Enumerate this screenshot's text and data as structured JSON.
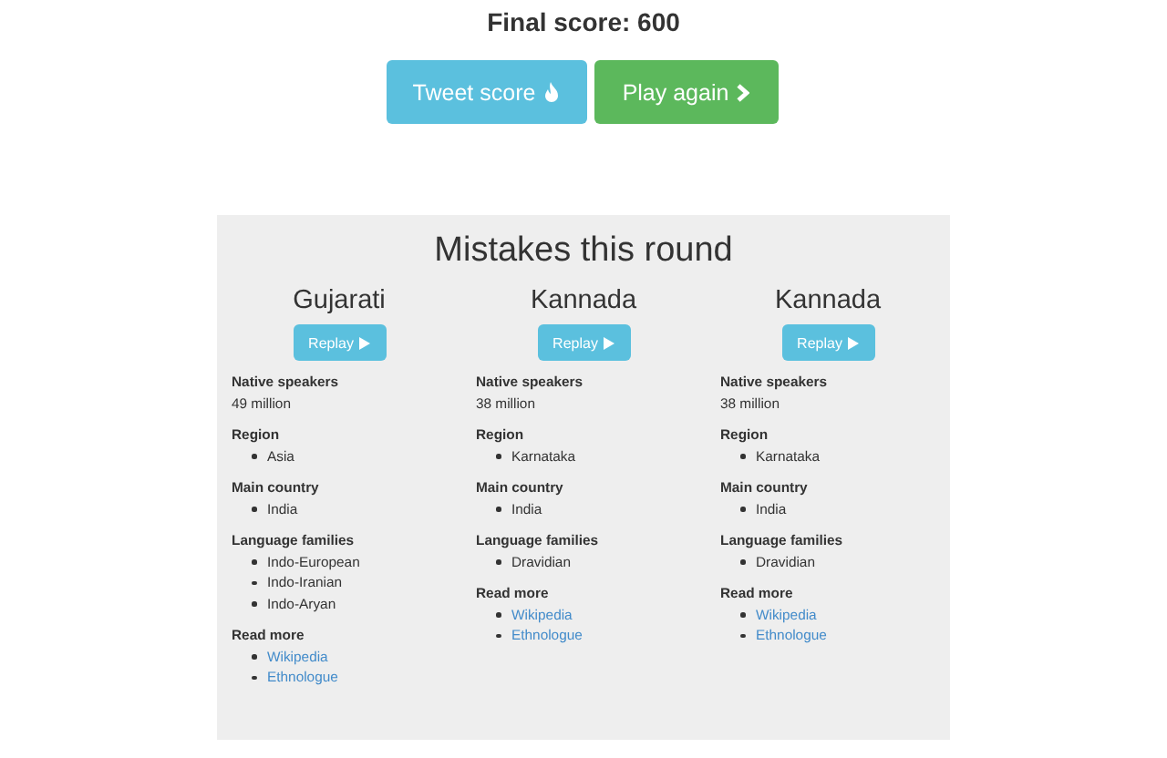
{
  "score": "Final score: 600",
  "buttons": [
    {
      "kind": "tweet",
      "label": "Tweet score"
    },
    {
      "kind": "play",
      "label": "Play again"
    }
  ],
  "mistakes": {
    "title": "Mistakes this round",
    "languages": [
      {
        "name": "Gujarati",
        "replay": "Replay",
        "sections": [
          {
            "kind": "text",
            "label": "Native speakers",
            "value": "49 million"
          },
          {
            "kind": "list",
            "label": "Region",
            "items": [
              "Asia"
            ]
          },
          {
            "kind": "list",
            "label": "Main country",
            "items": [
              "India"
            ]
          },
          {
            "kind": "list",
            "label": "Language families",
            "items": [
              "Indo-European",
              "Indo-Iranian",
              "Indo-Aryan"
            ]
          },
          {
            "kind": "links",
            "label": "Read more",
            "items": [
              "Wikipedia",
              "Ethnologue"
            ]
          }
        ]
      },
      {
        "name": "Kannada",
        "replay": "Replay",
        "sections": [
          {
            "kind": "text",
            "label": "Native speakers",
            "value": "38 million"
          },
          {
            "kind": "list",
            "label": "Region",
            "items": [
              "Karnataka"
            ]
          },
          {
            "kind": "list",
            "label": "Main country",
            "items": [
              "India"
            ]
          },
          {
            "kind": "list",
            "label": "Language families",
            "items": [
              "Dravidian"
            ]
          },
          {
            "kind": "links",
            "label": "Read more",
            "items": [
              "Wikipedia",
              "Ethnologue"
            ]
          }
        ]
      },
      {
        "name": "Kannada",
        "replay": "Replay",
        "sections": [
          {
            "kind": "text",
            "label": "Native speakers",
            "value": "38 million"
          },
          {
            "kind": "list",
            "label": "Region",
            "items": [
              "Karnataka"
            ]
          },
          {
            "kind": "list",
            "label": "Main country",
            "items": [
              "India"
            ]
          },
          {
            "kind": "list",
            "label": "Language families",
            "items": [
              "Dravidian"
            ]
          },
          {
            "kind": "links",
            "label": "Read more",
            "items": [
              "Wikipedia",
              "Ethnologue"
            ]
          }
        ]
      }
    ]
  }
}
